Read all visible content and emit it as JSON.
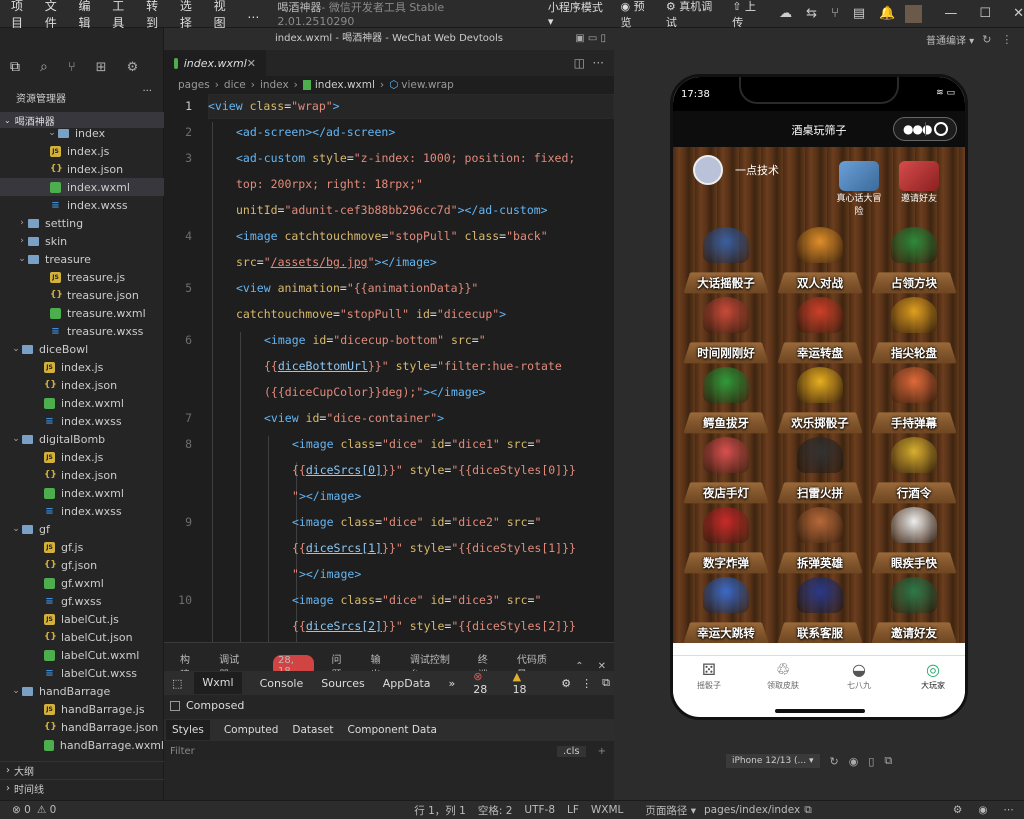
{
  "menubar": {
    "items": [
      "项目",
      "文件",
      "编辑",
      "工具",
      "转到",
      "选择",
      "视图",
      "…"
    ],
    "app_title": "喝酒神器",
    "app_subtitle": "- 微信开发者工具 Stable 2.01.2510290",
    "mode": "小程序模式 ▾",
    "preview": "预览",
    "real_debug": "真机调试",
    "upload": "上传"
  },
  "sidebar": {
    "header": "资源管理器",
    "root": "喝酒神器",
    "tree": [
      {
        "label": "index",
        "type": "fold",
        "indent": 60,
        "sel": false
      },
      {
        "label": "index.js",
        "type": "js",
        "indent": 50
      },
      {
        "label": "index.json",
        "type": "json",
        "indent": 50
      },
      {
        "label": "index.wxml",
        "type": "wxml",
        "indent": 50,
        "sel": true
      },
      {
        "label": "index.wxss",
        "type": "wxss",
        "indent": 50
      },
      {
        "label": "setting",
        "type": "fold",
        "indent": 30,
        "chev": "›"
      },
      {
        "label": "skin",
        "type": "fold",
        "indent": 30,
        "chev": "›"
      },
      {
        "label": "treasure",
        "type": "fold",
        "indent": 30,
        "chev": "⌄"
      },
      {
        "label": "treasure.js",
        "type": "js",
        "indent": 50
      },
      {
        "label": "treasure.json",
        "type": "json",
        "indent": 50
      },
      {
        "label": "treasure.wxml",
        "type": "wxml",
        "indent": 50
      },
      {
        "label": "treasure.wxss",
        "type": "wxss",
        "indent": 50
      },
      {
        "label": "diceBowl",
        "type": "fold",
        "indent": 24,
        "chev": "⌄"
      },
      {
        "label": "index.js",
        "type": "js",
        "indent": 44
      },
      {
        "label": "index.json",
        "type": "json",
        "indent": 44
      },
      {
        "label": "index.wxml",
        "type": "wxml",
        "indent": 44
      },
      {
        "label": "index.wxss",
        "type": "wxss",
        "indent": 44
      },
      {
        "label": "digitalBomb",
        "type": "fold",
        "indent": 24,
        "chev": "⌄"
      },
      {
        "label": "index.js",
        "type": "js",
        "indent": 44
      },
      {
        "label": "index.json",
        "type": "json",
        "indent": 44
      },
      {
        "label": "index.wxml",
        "type": "wxml",
        "indent": 44
      },
      {
        "label": "index.wxss",
        "type": "wxss",
        "indent": 44
      },
      {
        "label": "gf",
        "type": "fold",
        "indent": 24,
        "chev": "⌄"
      },
      {
        "label": "gf.js",
        "type": "js",
        "indent": 44
      },
      {
        "label": "gf.json",
        "type": "json",
        "indent": 44
      },
      {
        "label": "gf.wxml",
        "type": "wxml",
        "indent": 44
      },
      {
        "label": "gf.wxss",
        "type": "wxss",
        "indent": 44
      },
      {
        "label": "labelCut.js",
        "type": "js",
        "indent": 44
      },
      {
        "label": "labelCut.json",
        "type": "json",
        "indent": 44
      },
      {
        "label": "labelCut.wxml",
        "type": "wxml",
        "indent": 44
      },
      {
        "label": "labelCut.wxss",
        "type": "wxss",
        "indent": 44
      },
      {
        "label": "handBarrage",
        "type": "fold",
        "indent": 24,
        "chev": "⌄"
      },
      {
        "label": "handBarrage.js",
        "type": "js",
        "indent": 44
      },
      {
        "label": "handBarrage.json",
        "type": "json",
        "indent": 44
      },
      {
        "label": "handBarrage.wxml",
        "type": "wxml",
        "indent": 44
      }
    ],
    "outline": "大纲",
    "timeline": "时间线"
  },
  "editor": {
    "window_title": "index.wxml - 喝酒神器 - WeChat Web Devtools",
    "tab": "index.wxml",
    "crumbs": [
      "pages",
      "dice",
      "index",
      "index.wxml",
      "view.wrap"
    ]
  },
  "panel": {
    "tabs": [
      "构建",
      "调试器",
      "问题",
      "输出",
      "调试控制台",
      "终端",
      "代码质量"
    ],
    "badge": "28, 18",
    "devtabs": [
      "Wxml",
      "Console",
      "Sources",
      "AppData"
    ],
    "errors": "28",
    "warnings": "18",
    "composed": "Composed",
    "subtabs": [
      "Styles",
      "Computed",
      "Dataset",
      "Component Data"
    ],
    "filter": "Filter",
    "cls": ".cls"
  },
  "status": {
    "errs": "0",
    "warns": "0",
    "pos": "行 1，列 1",
    "spaces": "空格: 2",
    "enc": "UTF-8",
    "eol": "LF",
    "lang": "WXML",
    "page_path_label": "页面路径 ▾",
    "page_path": "pages/index/index"
  },
  "sim": {
    "compile": "普通编译 ▾",
    "time": "17:38",
    "nav_title": "酒桌玩筛子",
    "user": "一点技术",
    "mini": [
      {
        "label": "真心话大冒险"
      },
      {
        "label": "邀请好友"
      }
    ],
    "tiles": [
      "大话摇骰子",
      "双人对战",
      "占领方块",
      "时间刚刚好",
      "幸运转盘",
      "指尖轮盘",
      "鳄鱼拔牙",
      "欢乐掷骰子",
      "手持弹幕",
      "夜店手灯",
      "扫雷火拼",
      "行酒令",
      "数字炸弹",
      "拆弹英雄",
      "眼疾手快",
      "幸运大跳转",
      "联系客服",
      "邀请好友"
    ],
    "tabbar": [
      "摇骰子",
      "领取皮肤",
      "七八九",
      "大玩家"
    ],
    "device": "iPhone 12/13 (... ▾"
  },
  "colors": {
    "accent": "#62b6f5",
    "string": "#e38a7b",
    "attr": "#d9b96a",
    "badge": "#d04444"
  }
}
